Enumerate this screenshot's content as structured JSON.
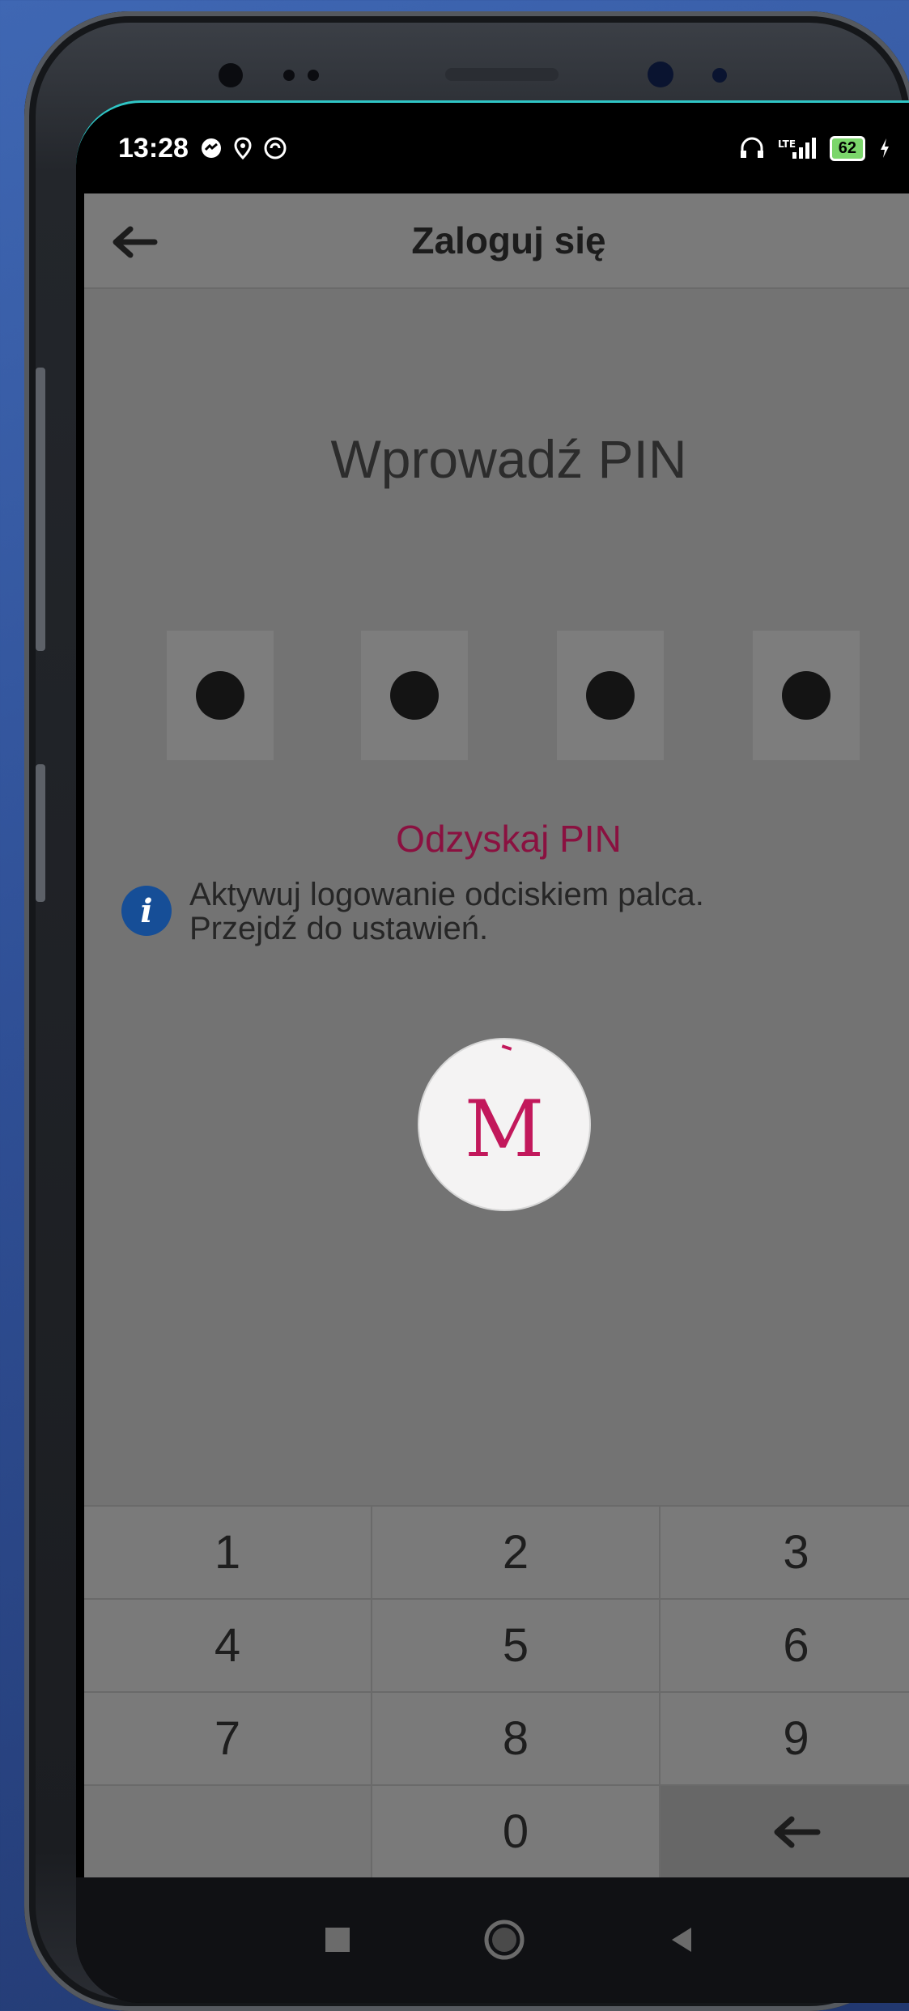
{
  "status_bar": {
    "time": "13:28",
    "battery": "62"
  },
  "app_bar": {
    "title": "Zaloguj się"
  },
  "pin_screen": {
    "heading": "Wprowadź PIN",
    "pin_length": 4,
    "entered_digits": 4,
    "recover_link": "Odzyskaj PIN",
    "info_line1": "Aktywuj logowanie odciskiem palca.",
    "info_line2": "Przejdź do ustawień."
  },
  "logo": {
    "letter": "M"
  },
  "keypad": {
    "k1": "1",
    "k2": "2",
    "k3": "3",
    "k4": "4",
    "k5": "5",
    "k6": "6",
    "k7": "7",
    "k8": "8",
    "k9": "9",
    "k0": "0"
  },
  "colors": {
    "accent": "#c2185b",
    "recover_link": "#8a1140",
    "info_icon": "#164e97"
  }
}
